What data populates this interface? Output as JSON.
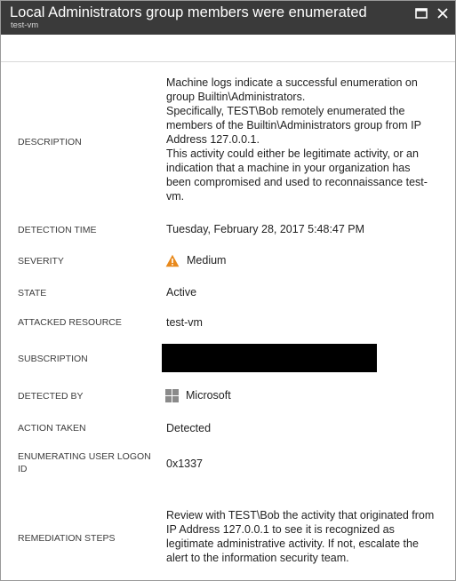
{
  "window": {
    "title": "Local Administrators group members were enumerated",
    "subtitle": "test-vm"
  },
  "rows": {
    "description": {
      "label": "DESCRIPTION",
      "lines": [
        "Machine logs indicate a successful enumeration on group Builtin\\Administrators.",
        "Specifically, TEST\\Bob remotely enumerated the members of the Builtin\\Administrators group from IP Address 127.0.0.1.",
        "This activity could either be legitimate activity, or an indication that a machine in your organization has been compromised and used to reconnaissance test-vm."
      ]
    },
    "detection_time": {
      "label": "DETECTION TIME",
      "value": "Tuesday, February 28, 2017 5:48:47 PM"
    },
    "severity": {
      "label": "SEVERITY",
      "value": "Medium",
      "icon": "warning-icon",
      "icon_color": "#e8891c"
    },
    "state": {
      "label": "STATE",
      "value": "Active"
    },
    "attacked_resource": {
      "label": "ATTACKED RESOURCE",
      "value": "test-vm"
    },
    "subscription": {
      "label": "SUBSCRIPTION"
    },
    "detected_by": {
      "label": "DETECTED BY",
      "value": "Microsoft",
      "icon": "windows-logo-icon"
    },
    "action_taken": {
      "label": "ACTION TAKEN",
      "value": "Detected"
    },
    "enumerating_user": {
      "label": "ENUMERATING USER LOGON ID",
      "value": "0x1337"
    },
    "remediation": {
      "label": "REMEDIATION STEPS",
      "value": "Review with TEST\\Bob the activity that originated from IP Address 127.0.0.1 to see it is recognized as legitimate administrative activity. If not, escalate the alert to the information security team."
    }
  }
}
